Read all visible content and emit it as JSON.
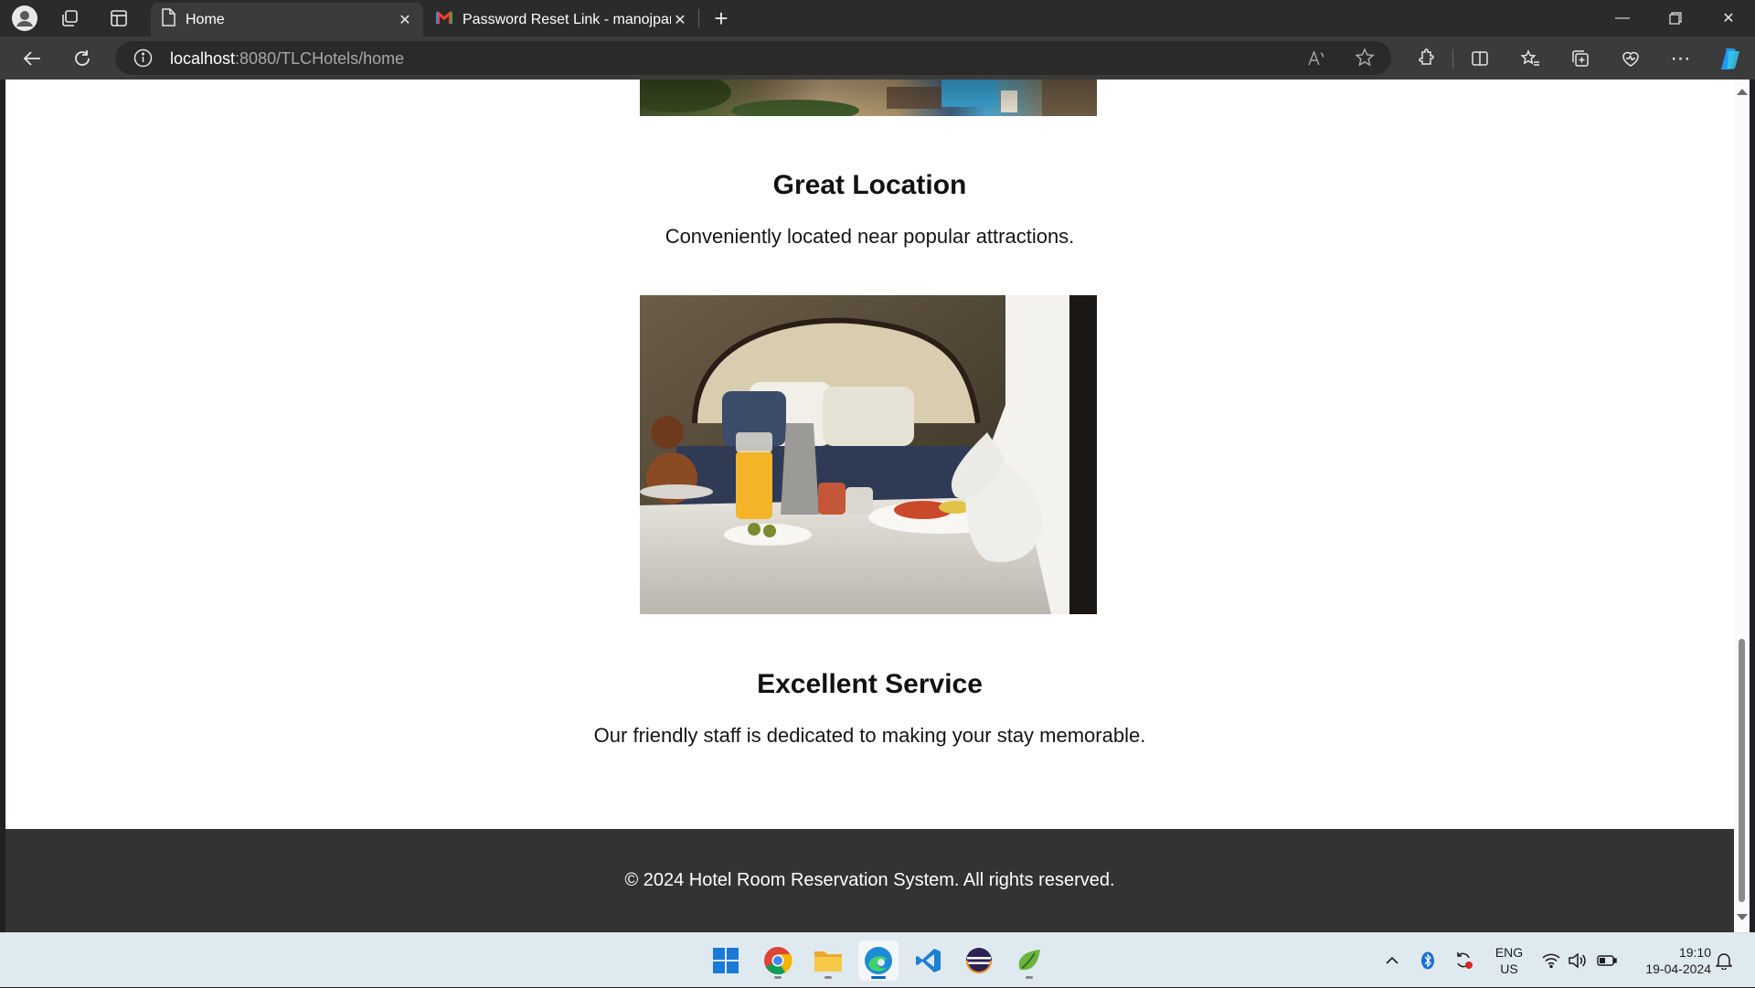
{
  "browser": {
    "tabs": [
      {
        "title": "Home",
        "active": true,
        "icon": "page-icon"
      },
      {
        "title": "Password Reset Link - manojpanc",
        "active": false,
        "icon": "gmail-icon"
      }
    ],
    "new_tab_label": "+",
    "address": {
      "host": "localhost",
      "rest": ":8080/TLCHotels/home"
    }
  },
  "page": {
    "features": [
      {
        "title": "Great Location",
        "description": "Conveniently located near popular attractions.",
        "image": "hotel-terrace-photo"
      },
      {
        "title": "Excellent Service",
        "description": "Our friendly staff is dedicated to making your stay memorable.",
        "image": "room-service-photo"
      }
    ],
    "footer": "© 2024 Hotel Room Reservation System. All rights reserved."
  },
  "taskbar": {
    "apps": [
      "windows-start-icon",
      "chrome-icon",
      "file-explorer-icon",
      "edge-icon",
      "vscode-icon",
      "eclipse-icon",
      "spring-tool-suite-icon"
    ],
    "active_app": "edge-icon",
    "language": {
      "line1": "ENG",
      "line2": "US"
    },
    "time": "19:10",
    "date": "19-04-2024"
  },
  "colors": {
    "footer_bg": "#333333",
    "browser_chrome": "#2b2b2b",
    "page_bg": "#ffffff"
  }
}
